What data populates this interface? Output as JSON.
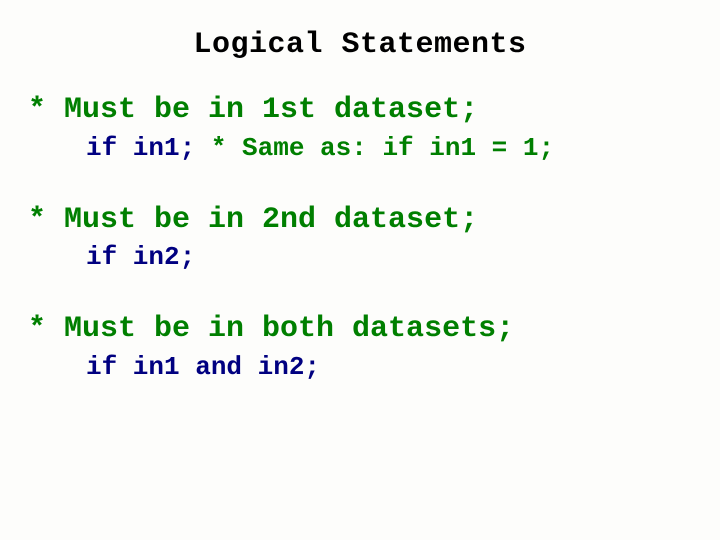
{
  "title": "Logical Statements",
  "blocks": [
    {
      "comment": "* Must be in 1st dataset;",
      "stmt": "if in1;",
      "inline_comment": " * Same as: if in1 = 1;"
    },
    {
      "comment": "* Must be in 2nd dataset;",
      "stmt": "if in2;",
      "inline_comment": ""
    },
    {
      "comment": "* Must be in both datasets;",
      "stmt": "if in1 and in2;",
      "inline_comment": ""
    }
  ]
}
